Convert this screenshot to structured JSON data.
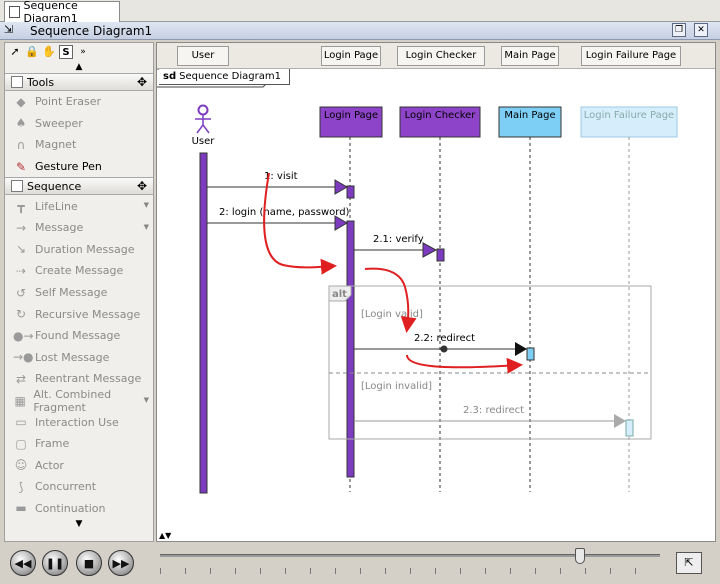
{
  "tab": {
    "title": "Sequence Diagram1"
  },
  "window": {
    "title": "Sequence Diagram1"
  },
  "palette": {
    "tool_icons": [
      "pointer-icon",
      "lock-icon",
      "hand-icon",
      "s-icon",
      "more-icon"
    ],
    "s_label": "S",
    "sections": [
      {
        "label": "Tools",
        "items": [
          {
            "label": "Point Eraser",
            "icon": "eraser-icon"
          },
          {
            "label": "Sweeper",
            "icon": "sweeper-icon"
          },
          {
            "label": "Magnet",
            "icon": "magnet-icon"
          },
          {
            "label": "Gesture Pen",
            "icon": "pen-icon",
            "active": true
          }
        ]
      },
      {
        "label": "Sequence",
        "items": [
          {
            "label": "LifeLine",
            "icon": "lifeline-icon",
            "dropdown": true
          },
          {
            "label": "Message",
            "icon": "message-icon",
            "dropdown": true
          },
          {
            "label": "Duration Message",
            "icon": "duration-message-icon"
          },
          {
            "label": "Create Message",
            "icon": "create-message-icon"
          },
          {
            "label": "Self Message",
            "icon": "self-message-icon"
          },
          {
            "label": "Recursive Message",
            "icon": "recursive-message-icon"
          },
          {
            "label": "Found Message",
            "icon": "found-message-icon"
          },
          {
            "label": "Lost Message",
            "icon": "lost-message-icon"
          },
          {
            "label": "Reentrant Message",
            "icon": "reentrant-message-icon"
          },
          {
            "label": "Alt. Combined Fragment",
            "icon": "combined-fragment-icon",
            "dropdown": true
          },
          {
            "label": "Interaction Use",
            "icon": "interaction-use-icon"
          },
          {
            "label": "Frame",
            "icon": "frame-icon"
          },
          {
            "label": "Actor",
            "icon": "actor-icon"
          },
          {
            "label": "Concurrent",
            "icon": "concurrent-icon"
          },
          {
            "label": "Continuation",
            "icon": "continuation-icon"
          }
        ]
      }
    ]
  },
  "lifeline_header": [
    "User",
    "Login Page",
    "Login Checker",
    "Main Page",
    "Login Failure Page"
  ],
  "diagram": {
    "frame_kind": "sd",
    "frame_name": "Sequence Diagram1",
    "actor": {
      "label": "User"
    },
    "lifelines": [
      {
        "label": "Login Page",
        "color": "#8e44c8"
      },
      {
        "label": "Login Checker",
        "color": "#8e44c8"
      },
      {
        "label": "Main Page",
        "color": "#7ecff5"
      },
      {
        "label": "Login Failure Page",
        "color": "#d6eefb"
      }
    ],
    "messages": [
      {
        "label": "1: visit"
      },
      {
        "label": "2: login (name, password)"
      },
      {
        "label": "2.1: verify"
      },
      {
        "label": "2.2: redirect"
      },
      {
        "label": "2.3: redirect"
      }
    ],
    "fragment": {
      "operator": "alt",
      "guards": [
        "[Login valid]",
        "[Login invalid]"
      ]
    },
    "colors": {
      "activation": "#7d3cc0",
      "gesture": "#e02020"
    }
  },
  "player": {
    "buttons": [
      "rewind-icon",
      "pause-icon",
      "stop-icon",
      "forward-icon"
    ],
    "position": 0.84
  }
}
